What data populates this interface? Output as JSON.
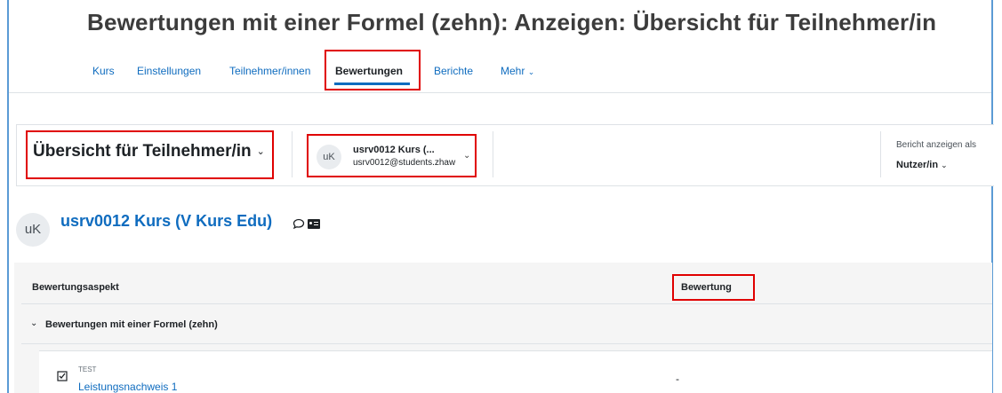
{
  "page": {
    "title": "Bewertungen mit einer Formel (zehn): Anzeigen: Übersicht für Teilnehmer/in"
  },
  "nav": {
    "items": [
      {
        "label": "Kurs"
      },
      {
        "label": "Einstellungen"
      },
      {
        "label": "Teilnehmer/innen"
      },
      {
        "label": "Bewertungen"
      },
      {
        "label": "Berichte"
      },
      {
        "label": "Mehr"
      }
    ],
    "active": "Bewertungen"
  },
  "toolbar": {
    "report_select": "Übersicht für Teilnehmer/in",
    "user": {
      "initials": "uK",
      "name": "usrv0012 Kurs (...",
      "email": "usrv0012@students.zhaw"
    },
    "view_as_label": "Bericht anzeigen als",
    "view_as_value": "Nutzer/in"
  },
  "user_header": {
    "initials": "uK",
    "name": "usrv0012 Kurs (V Kurs Edu)"
  },
  "table": {
    "columns": [
      "Bewertungsaspekt",
      "Bewertung"
    ],
    "category": "Bewertungen mit einer Formel (zehn)",
    "items": [
      {
        "type": "TEST",
        "name": "Leistungsnachweis 1",
        "grade": "-"
      }
    ]
  },
  "icons": {
    "chevron": "chevron-down-icon",
    "message": "speech-bubble-icon",
    "profile": "id-card-icon",
    "quiz": "checkbox-icon"
  },
  "colors": {
    "link": "#0f6cbf",
    "highlight": "#e00000",
    "frame": "#5b9bd5"
  }
}
